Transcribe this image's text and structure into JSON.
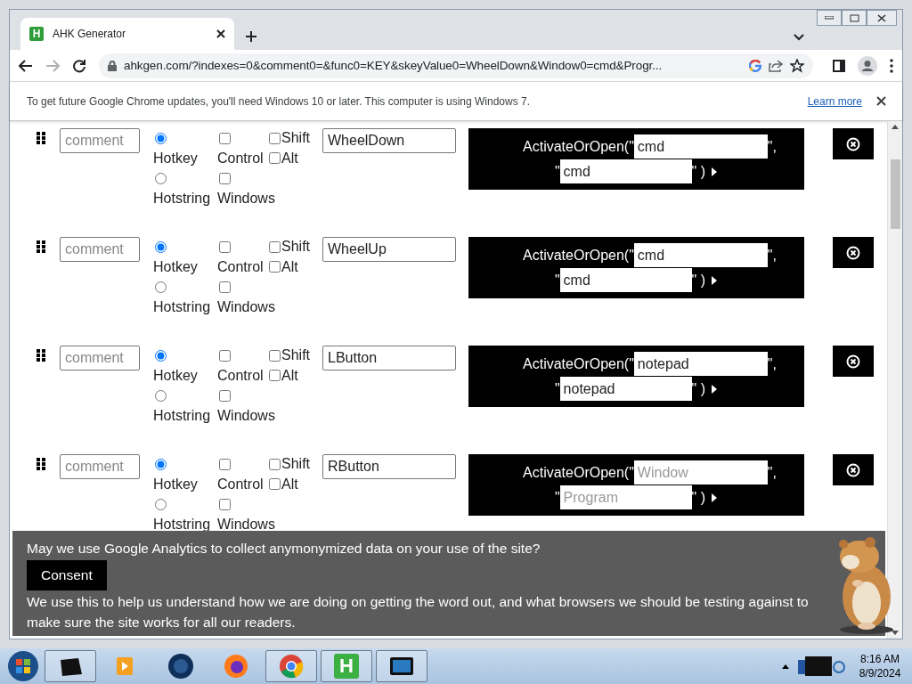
{
  "browser": {
    "tab_title": "AHK Generator",
    "favicon_letter": "H",
    "url": "ahkgen.com/?indexes=0&comment0=&func0=KEY&skeyValue0=WheelDown&Window0=cmd&Progr..."
  },
  "info_bar": {
    "message": "To get future Google Chrome updates, you'll need Windows 10 or later. This computer is using Windows 7.",
    "link": "Learn more"
  },
  "rows": [
    {
      "comment_placeholder": "comment",
      "type_options": [
        {
          "label": "Hotkey",
          "selected": true
        },
        {
          "label": "Hotstring",
          "selected": false
        }
      ],
      "modifiers": [
        {
          "label": "Control",
          "checked": false
        },
        {
          "label": "Windows",
          "checked": false
        },
        {
          "label": "Shift",
          "checked": false
        },
        {
          "label": "Alt",
          "checked": false
        }
      ],
      "key": "WheelDown",
      "call_start": "ActivateOrOpen(\"",
      "call_mid": "\",",
      "quote": "\"",
      "call_end": "\" )",
      "window_field": {
        "value": "cmd"
      },
      "program_field": {
        "value": "cmd"
      }
    },
    {
      "comment_placeholder": "comment",
      "type_options": [
        {
          "label": "Hotkey",
          "selected": true
        },
        {
          "label": "Hotstring",
          "selected": false
        }
      ],
      "modifiers": [
        {
          "label": "Control",
          "checked": false
        },
        {
          "label": "Windows",
          "checked": false
        },
        {
          "label": "Shift",
          "checked": false
        },
        {
          "label": "Alt",
          "checked": false
        }
      ],
      "key": "WheelUp",
      "call_start": "ActivateOrOpen(\"",
      "call_mid": "\",",
      "quote": "\"",
      "call_end": "\" )",
      "window_field": {
        "value": "cmd"
      },
      "program_field": {
        "value": "cmd"
      }
    },
    {
      "comment_placeholder": "comment",
      "type_options": [
        {
          "label": "Hotkey",
          "selected": true
        },
        {
          "label": "Hotstring",
          "selected": false
        }
      ],
      "modifiers": [
        {
          "label": "Control",
          "checked": false
        },
        {
          "label": "Windows",
          "checked": false
        },
        {
          "label": "Shift",
          "checked": false
        },
        {
          "label": "Alt",
          "checked": false
        }
      ],
      "key": "LButton",
      "call_start": "ActivateOrOpen(\"",
      "call_mid": "\",",
      "quote": "\"",
      "call_end": "\" )",
      "window_field": {
        "value": "notepad"
      },
      "program_field": {
        "value": "notepad"
      }
    },
    {
      "comment_placeholder": "comment",
      "type_options": [
        {
          "label": "Hotkey",
          "selected": true
        },
        {
          "label": "Hotstring",
          "selected": false
        }
      ],
      "modifiers": [
        {
          "label": "Control",
          "checked": false
        },
        {
          "label": "Windows",
          "checked": false
        },
        {
          "label": "Shift",
          "checked": false
        },
        {
          "label": "Alt",
          "checked": false
        }
      ],
      "key": "RButton",
      "call_start": "ActivateOrOpen(\"",
      "call_mid": "\",",
      "quote": "\"",
      "call_end": "\" )",
      "window_field": {
        "placeholder": "Window"
      },
      "program_field": {
        "placeholder": "Program"
      }
    }
  ],
  "consent_banner": {
    "question": "May we use Google Analytics to collect anymonymized data on your use of the site?",
    "button": "Consent",
    "explanation": "We use this to help us understand how we are doing on getting the word out, and what browsers we should be testing against to make sure the site works for all our readers."
  },
  "taskbar": {
    "app_letter": "H",
    "time": "8:16 AM",
    "date": "8/9/2024"
  }
}
